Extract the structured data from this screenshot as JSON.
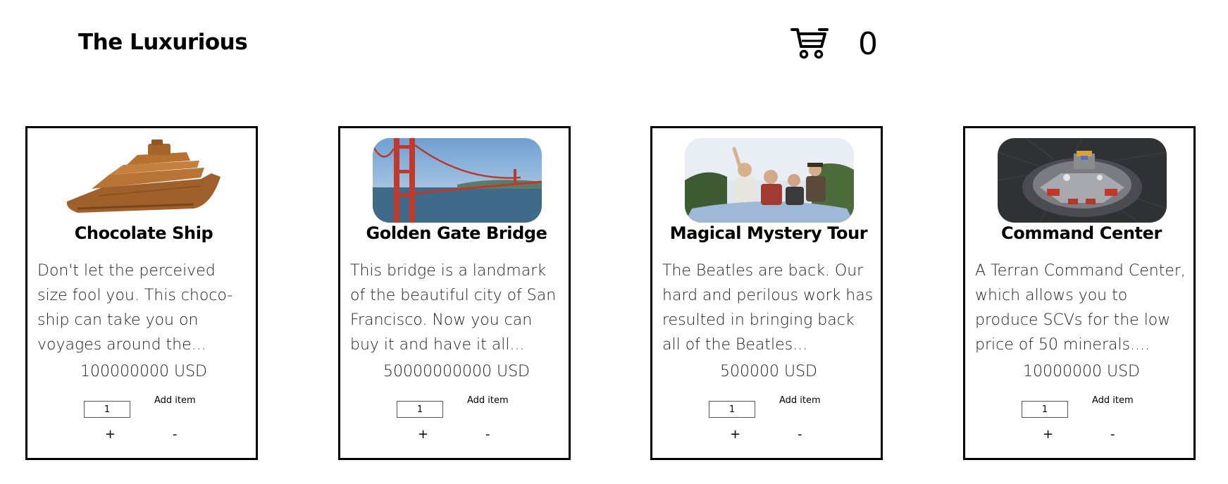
{
  "header": {
    "logo": "The Luxurious",
    "cart_icon": "shopping-cart-icon",
    "cart_count": "0"
  },
  "products": [
    {
      "title": "Chocolate Ship",
      "description": "Don't let the perceived size fool you. This choco-ship can take you on voyages around the...",
      "price": "100000000 USD",
      "quantity": "1",
      "add_label": "Add item",
      "plus_label": "+",
      "minus_label": "-",
      "image": "chocolate-ship-image"
    },
    {
      "title": "Golden Gate Bridge",
      "description": "This bridge is a landmark of the beautiful city of San Francisco. Now you can buy it and have it all...",
      "price": "50000000000 USD",
      "quantity": "1",
      "add_label": "Add item",
      "plus_label": "+",
      "minus_label": "-",
      "image": "golden-gate-bridge-image"
    },
    {
      "title": "Magical Mystery Tour",
      "description": "The Beatles are back. Our hard and perilous work has resulted in bringing back all of the Beatles...",
      "price": "500000 USD",
      "quantity": "1",
      "add_label": "Add item",
      "plus_label": "+",
      "minus_label": "-",
      "image": "magical-mystery-tour-image"
    },
    {
      "title": "Command Center",
      "description": "A Terran Command Center, which allows you to produce SCVs for the low price of 50 minerals....",
      "price": "10000000 USD",
      "quantity": "1",
      "add_label": "Add item",
      "plus_label": "+",
      "minus_label": "-",
      "image": "command-center-image"
    }
  ]
}
